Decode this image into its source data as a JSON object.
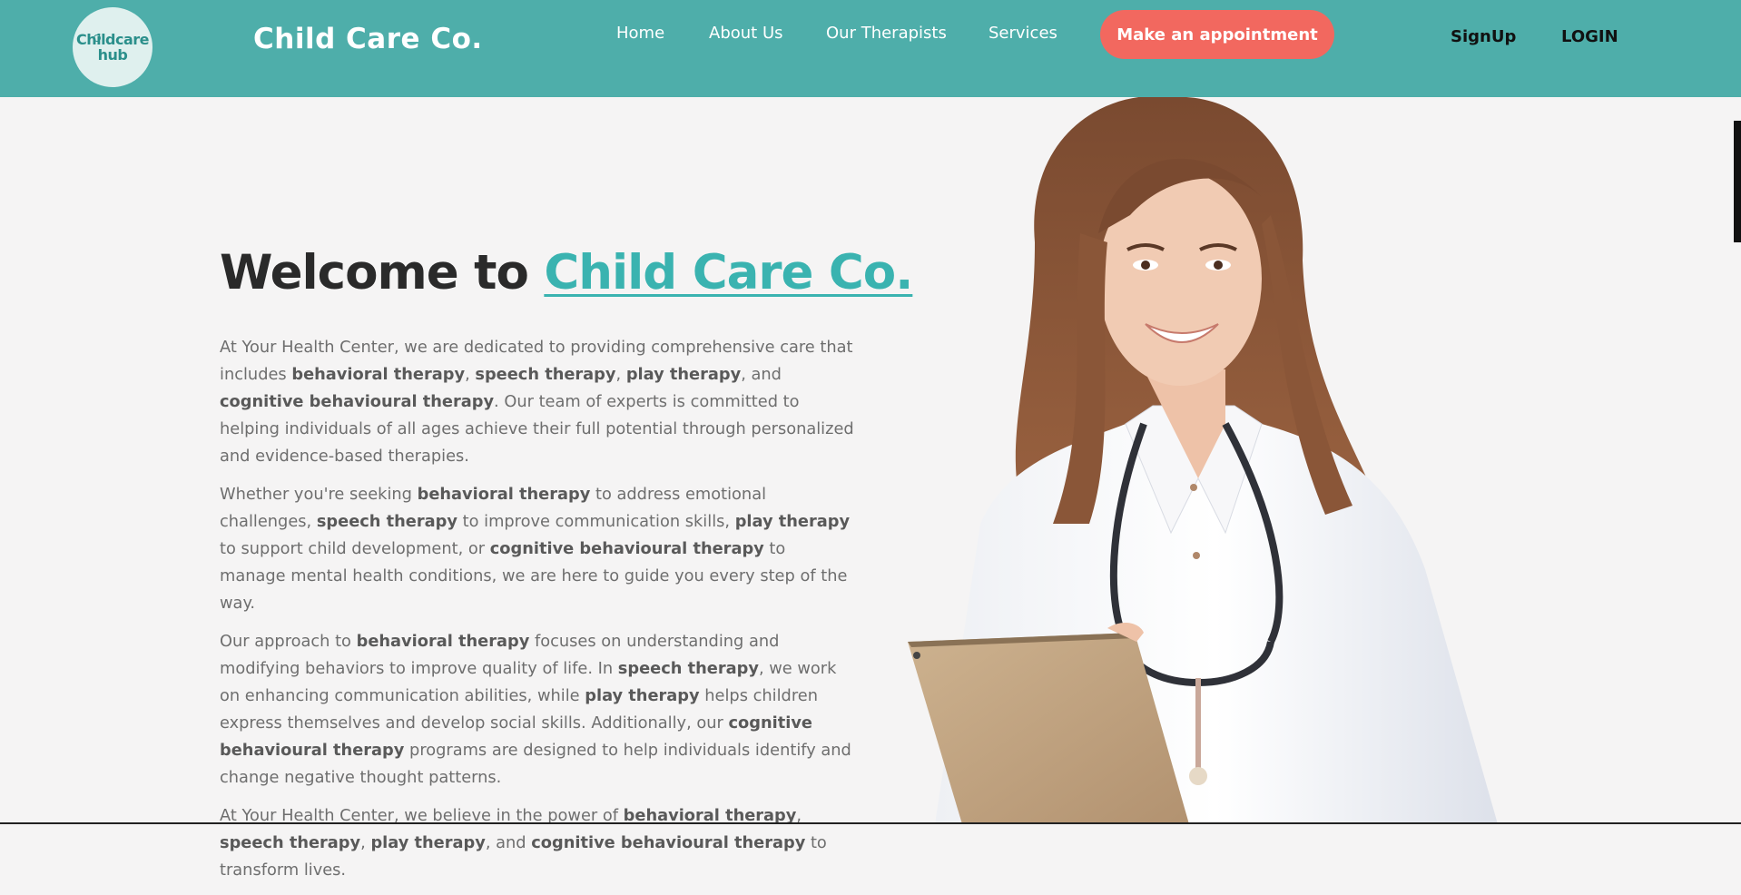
{
  "header": {
    "logo_line1": "Childcare",
    "logo_line2": "hub",
    "brand": "Child Care Co.",
    "nav": [
      {
        "label": "Home"
      },
      {
        "label": "About Us"
      },
      {
        "label": "Our Therapists"
      },
      {
        "label": "Services"
      }
    ],
    "appointment_label": "Make an appointment",
    "signup_label": "SignUp",
    "login_label": "LOGIN"
  },
  "hero": {
    "title_prefix": "Welcome to ",
    "title_accent": "Child Care Co.",
    "paragraphs": [
      [
        {
          "t": "At Your Health Center, we are dedicated to providing comprehensive care that includes "
        },
        {
          "t": "behavioral therapy",
          "b": true
        },
        {
          "t": ", "
        },
        {
          "t": "speech therapy",
          "b": true
        },
        {
          "t": ", "
        },
        {
          "t": "play therapy",
          "b": true
        },
        {
          "t": ", and "
        },
        {
          "t": "cognitive behavioural therapy",
          "b": true
        },
        {
          "t": ". Our team of experts is committed to helping individuals of all ages achieve their full potential through personalized and evidence-based therapies."
        }
      ],
      [
        {
          "t": "Whether you're seeking "
        },
        {
          "t": "behavioral therapy",
          "b": true
        },
        {
          "t": " to address emotional challenges, "
        },
        {
          "t": "speech therapy",
          "b": true
        },
        {
          "t": " to improve communication skills, "
        },
        {
          "t": "play therapy",
          "b": true
        },
        {
          "t": " to support child development, or "
        },
        {
          "t": "cognitive behavioural therapy",
          "b": true
        },
        {
          "t": " to manage mental health conditions, we are here to guide you every step of the way."
        }
      ],
      [
        {
          "t": "Our approach to "
        },
        {
          "t": "behavioral therapy",
          "b": true
        },
        {
          "t": " focuses on understanding and modifying behaviors to improve quality of life. In "
        },
        {
          "t": "speech therapy",
          "b": true
        },
        {
          "t": ", we work on enhancing communication abilities, while "
        },
        {
          "t": "play therapy",
          "b": true
        },
        {
          "t": " helps children express themselves and develop social skills. Additionally, our "
        },
        {
          "t": "cognitive behavioural therapy",
          "b": true
        },
        {
          "t": " programs are designed to help individuals identify and change negative thought patterns."
        }
      ],
      [
        {
          "t": "At Your Health Center, we believe in the power of "
        },
        {
          "t": "behavioral therapy",
          "b": true
        },
        {
          "t": ", "
        },
        {
          "t": "speech therapy",
          "b": true
        },
        {
          "t": ", "
        },
        {
          "t": "play therapy",
          "b": true
        },
        {
          "t": ", and "
        },
        {
          "t": "cognitive behavioural therapy",
          "b": true
        },
        {
          "t": " to transform lives."
        }
      ]
    ]
  },
  "colors": {
    "header_bg": "#4eaeaa",
    "accent": "#3ab3b0",
    "cta": "#f2685f",
    "page_bg": "#f5f4f4"
  }
}
